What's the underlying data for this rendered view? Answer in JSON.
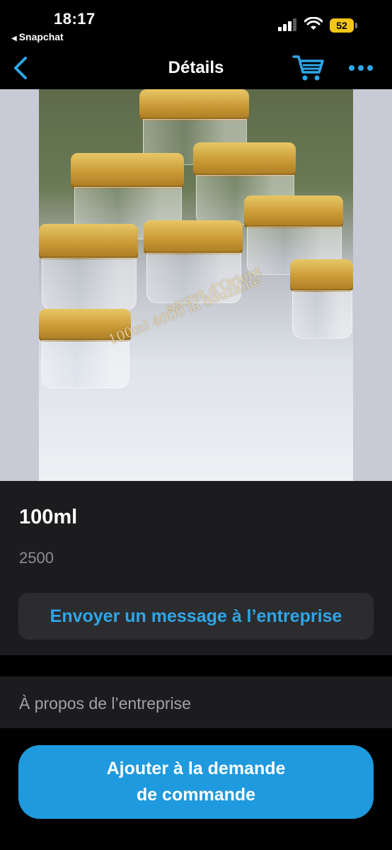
{
  "status_bar": {
    "time": "18:17",
    "back_app": "Snapchat",
    "battery": "52"
  },
  "nav": {
    "title": "Détails",
    "back_icon": "chevron-left-icon",
    "cart_icon": "cart-icon",
    "more_icon": "ellipsis-icon"
  },
  "photo": {
    "watermark_line1": "secret d'Orient",
    "watermark_line2": "100ml 4000 la douzaine"
  },
  "product": {
    "name": "100ml",
    "price": "2500",
    "message_button": "Envoyer un message à l’entreprise"
  },
  "about": {
    "label": "À propos de l’entreprise"
  },
  "cta": {
    "line1": "Ajouter à la demande",
    "line2": "de commande"
  },
  "colors": {
    "accent": "#2ea6e8",
    "cta_background": "#1f9ade",
    "card_background": "#1c1c1e",
    "battery": "#f5c518"
  }
}
